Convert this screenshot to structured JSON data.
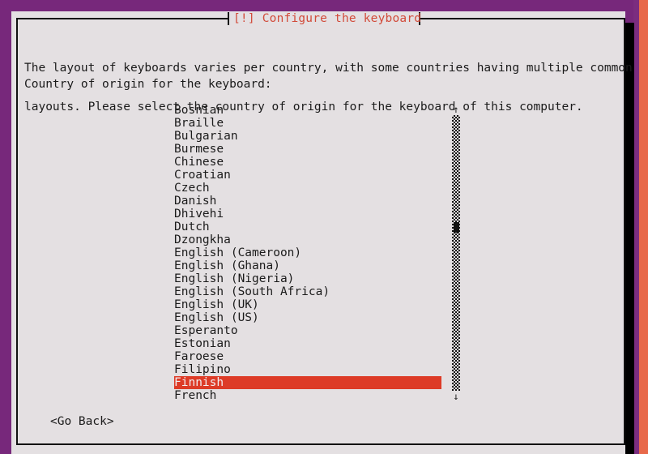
{
  "window": {
    "title": "[!] Configure the keyboard",
    "desktop_background_color": "#77287b",
    "panel_background_color": "#e4e0e2",
    "accent_stripe_color": "#e8694a",
    "title_color": "#d24b3a",
    "highlight_color": "#dd3b27",
    "text_color": "#1b1b1b"
  },
  "body": {
    "paragraph_line_1": "The layout of keyboards varies per country, with some countries having multiple common",
    "paragraph_line_2": "layouts. Please select the country of origin for the keyboard of this computer.",
    "prompt": "Country of origin for the keyboard:"
  },
  "list": {
    "selected_index": 21,
    "items": [
      "Bosnian",
      "Braille",
      "Bulgarian",
      "Burmese",
      "Chinese",
      "Croatian",
      "Czech",
      "Danish",
      "Dhivehi",
      "Dutch",
      "Dzongkha",
      "English (Cameroon)",
      "English (Ghana)",
      "English (Nigeria)",
      "English (South Africa)",
      "English (UK)",
      "English (US)",
      "Esperanto",
      "Estonian",
      "Faroese",
      "Filipino",
      "Finnish",
      "French"
    ]
  },
  "scrollbar": {
    "up_arrow": "↑",
    "down_arrow": "↓"
  },
  "buttons": {
    "go_back": "<Go Back>"
  }
}
